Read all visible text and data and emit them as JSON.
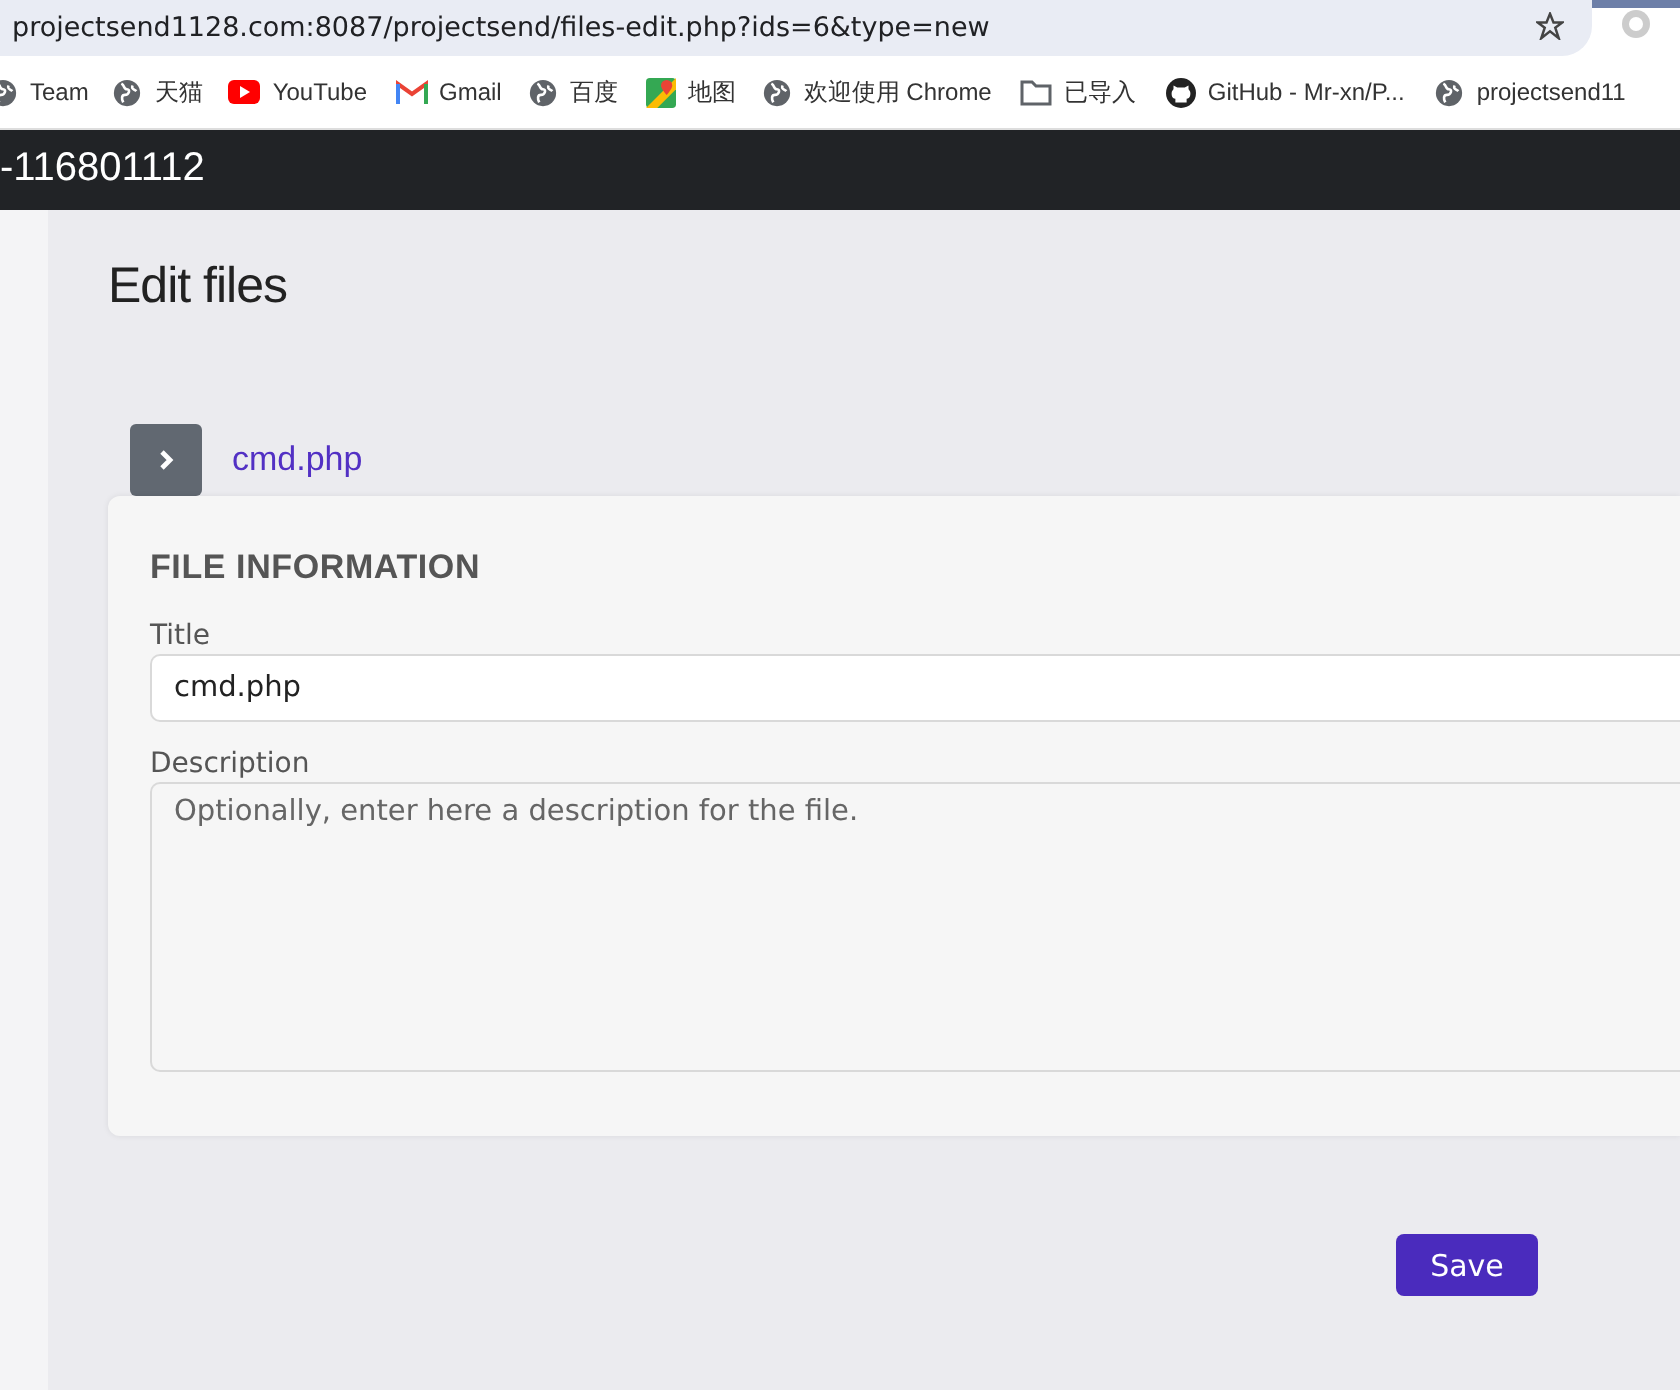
{
  "browser": {
    "url": "projectsend1128.com:8087/projectsend/files-edit.php?ids=6&type=new",
    "bookmarks": [
      {
        "label": "Team",
        "kind": "globe"
      },
      {
        "label": "天猫",
        "kind": "globe"
      },
      {
        "label": "YouTube",
        "kind": "youtube"
      },
      {
        "label": "Gmail",
        "kind": "gmail"
      },
      {
        "label": "百度",
        "kind": "globe"
      },
      {
        "label": "地图",
        "kind": "maps"
      },
      {
        "label": "欢迎使用 Chrome",
        "kind": "globe"
      },
      {
        "label": "已导入",
        "kind": "folder"
      },
      {
        "label": "GitHub - Mr-xn/P...",
        "kind": "github"
      },
      {
        "label": "projectsend11",
        "kind": "globe"
      }
    ]
  },
  "header": {
    "title": "-116801112"
  },
  "page": {
    "title": "Edit files",
    "file": {
      "name": "cmd.php",
      "expanded": false
    },
    "section_title": "FILE INFORMATION",
    "fields": [
      {
        "label": "Title",
        "value": "cmd.php",
        "kind": "text"
      },
      {
        "label": "Description",
        "placeholder": "Optionally, enter here a description for the file.",
        "kind": "textarea"
      }
    ],
    "buttons": [
      "Save"
    ]
  }
}
